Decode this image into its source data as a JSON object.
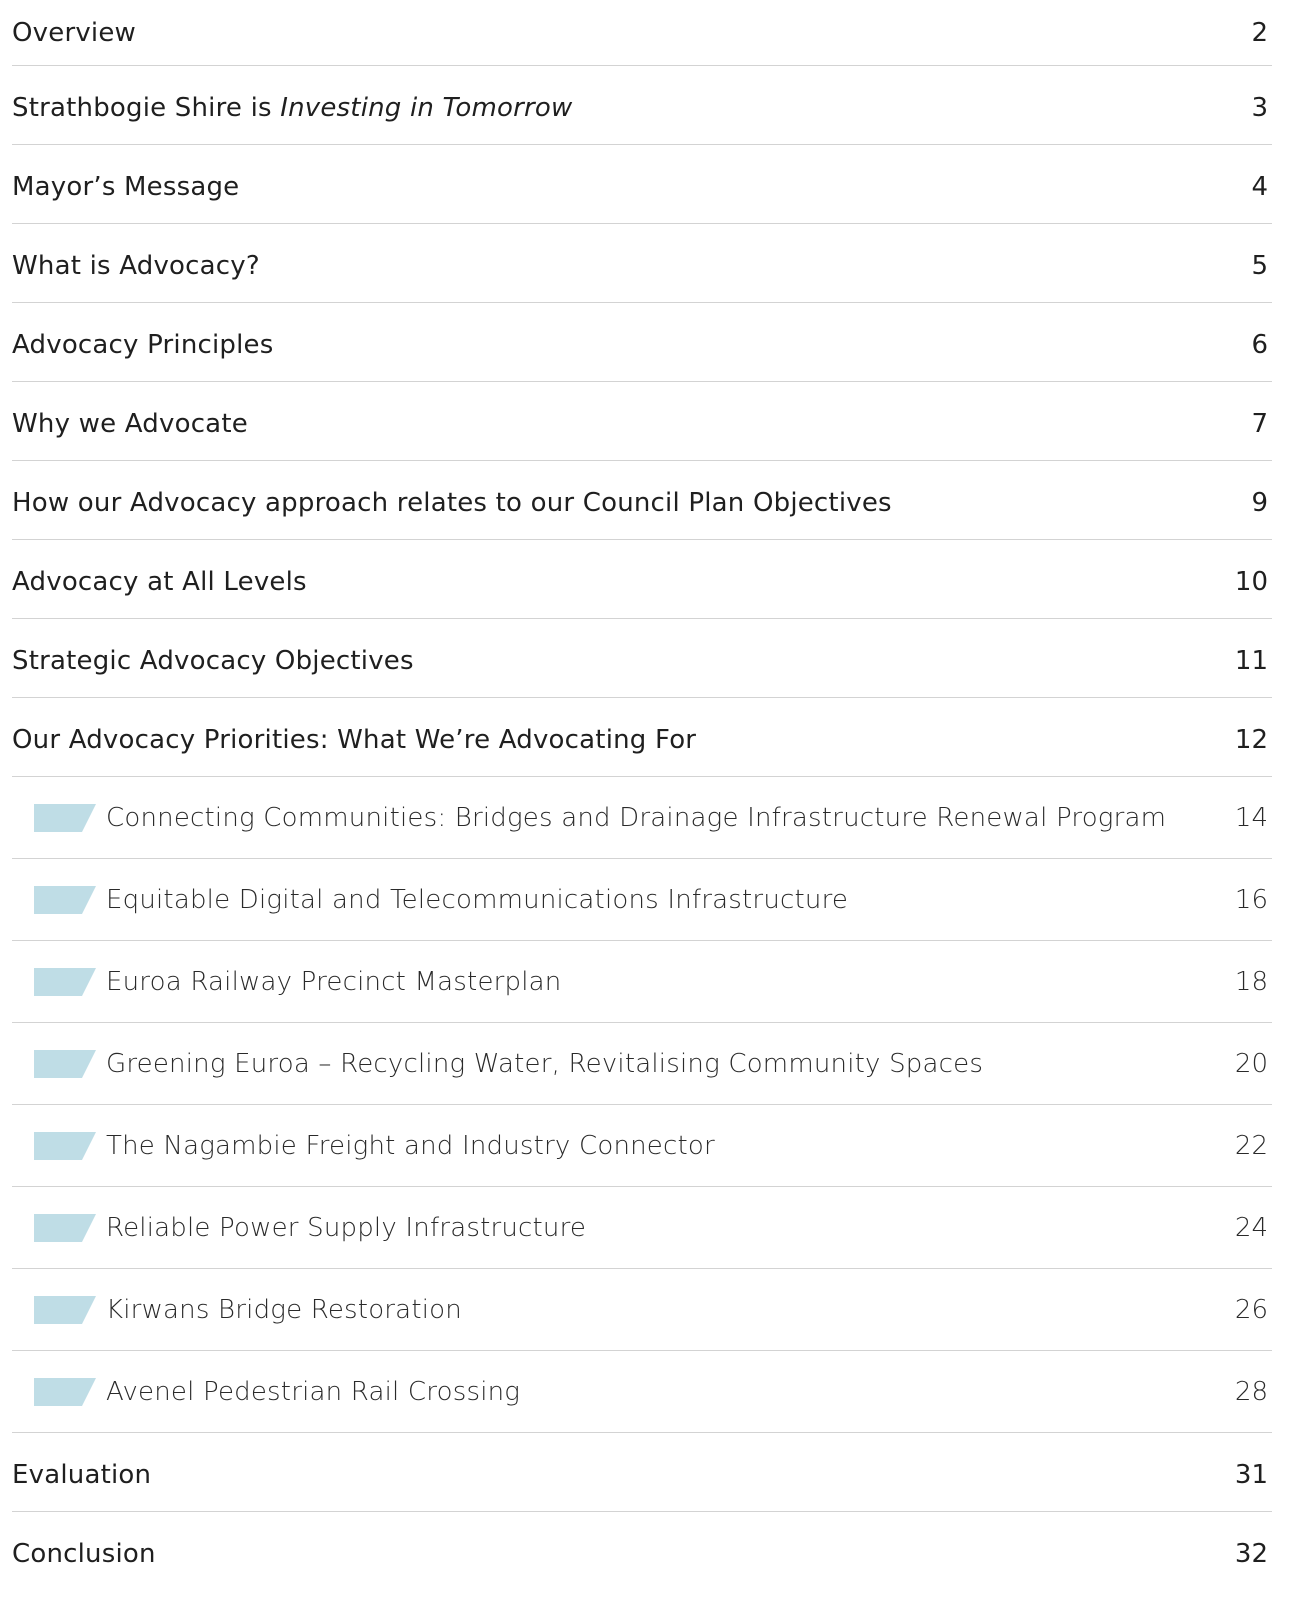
{
  "colors": {
    "marker": "#bfdde6",
    "divider": "#d3d3d3",
    "text": "#1f1f1f"
  },
  "toc": {
    "entries": [
      {
        "title": "Overview",
        "page": "2"
      },
      {
        "title_prefix": "Strathbogie Shire is ",
        "title_italic": "Investing in Tomorrow",
        "page": "3"
      },
      {
        "title": "Mayor’s Message",
        "page": "4"
      },
      {
        "title": "What is Advocacy?",
        "page": "5"
      },
      {
        "title": "Advocacy Principles",
        "page": "6"
      },
      {
        "title": "Why we Advocate",
        "page": "7"
      },
      {
        "title": "How our Advocacy approach relates to our Council Plan Objectives",
        "page": "9"
      },
      {
        "title": "Advocacy at All Levels",
        "page": "10"
      },
      {
        "title": "Strategic Advocacy Objectives",
        "page": "11"
      },
      {
        "title": "Our Advocacy Priorities: What We’re Advocating For",
        "page": "12"
      }
    ],
    "sub_entries": [
      {
        "title": "Connecting Communities: Bridges and Drainage Infrastructure Renewal Program",
        "page": "14"
      },
      {
        "title": "Equitable Digital and Telecommunications Infrastructure",
        "page": "16"
      },
      {
        "title": "Euroa Railway Precinct Masterplan",
        "page": "18"
      },
      {
        "title": "Greening Euroa – Recycling Water, Revitalising Community Spaces",
        "page": "20"
      },
      {
        "title": "The Nagambie Freight and Industry Connector",
        "page": "22"
      },
      {
        "title": "Reliable Power Supply Infrastructure",
        "page": "24"
      },
      {
        "title": "Kirwans Bridge Restoration",
        "page": "26"
      },
      {
        "title": "Avenel Pedestrian Rail Crossing",
        "page": "28"
      }
    ],
    "end_entries": [
      {
        "title": "Evaluation",
        "page": "31"
      },
      {
        "title": "Conclusion",
        "page": "32"
      }
    ]
  }
}
